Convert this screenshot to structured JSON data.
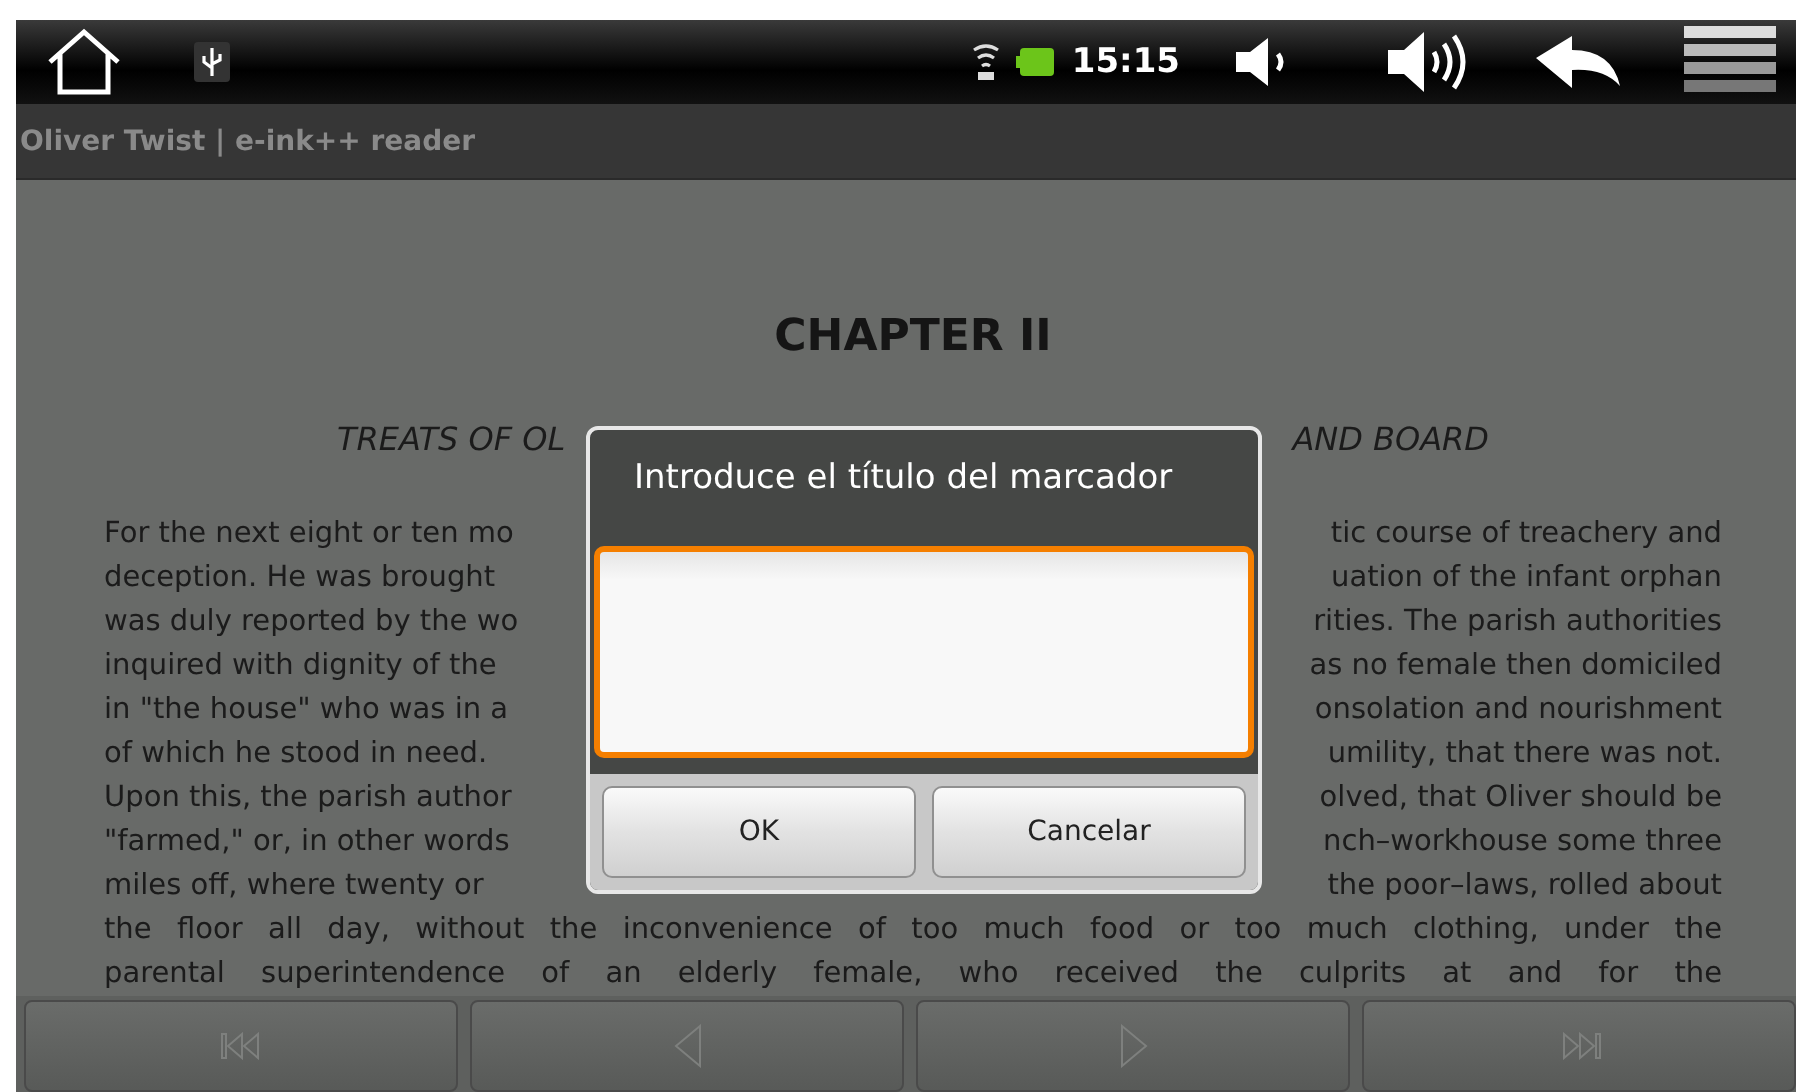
{
  "status_bar": {
    "time": "15:15"
  },
  "app_title": "Oliver Twist | e-ink++ reader",
  "page": {
    "chapter": "CHAPTER II",
    "subtitle_left": "TREATS OF OL",
    "subtitle_right": "AND BOARD",
    "lines": [
      {
        "left": "For the next eight or ten mo",
        "right": "tic course of treachery and"
      },
      {
        "left": "deception. He was brought",
        "right": "uation of the infant orphan"
      },
      {
        "left": "was duly reported by the wo",
        "right": "rities. The parish authorities"
      },
      {
        "left": "inquired with dignity of the",
        "right": "as no female then domiciled"
      },
      {
        "left": "in \"the house\" who was in a",
        "right": "onsolation and nourishment"
      },
      {
        "left": "of which he stood in need.",
        "right": "umility, that there was not."
      },
      {
        "left": "Upon this, the parish author",
        "right": "olved, that Oliver should be"
      },
      {
        "left": "\"farmed,\" or, in other words",
        "right": "nch–workhouse some three"
      },
      {
        "left": "miles off, where twenty or",
        "right": "the poor–laws, rolled about"
      },
      {
        "text": "the floor all day, without the inconvenience of too much food or too much clothing, under the"
      },
      {
        "text": "parental superintendence of an elderly female, who received the culprits at and for the"
      }
    ]
  },
  "dialog": {
    "title": "Introduce el título del marcador",
    "field": {
      "focused": true
    },
    "buttons": [
      "OK",
      "Cancelar"
    ]
  },
  "toolbar": [
    {
      "kind": "first"
    },
    {
      "kind": "prev"
    },
    {
      "kind": "next"
    },
    {
      "kind": "last"
    }
  ]
}
